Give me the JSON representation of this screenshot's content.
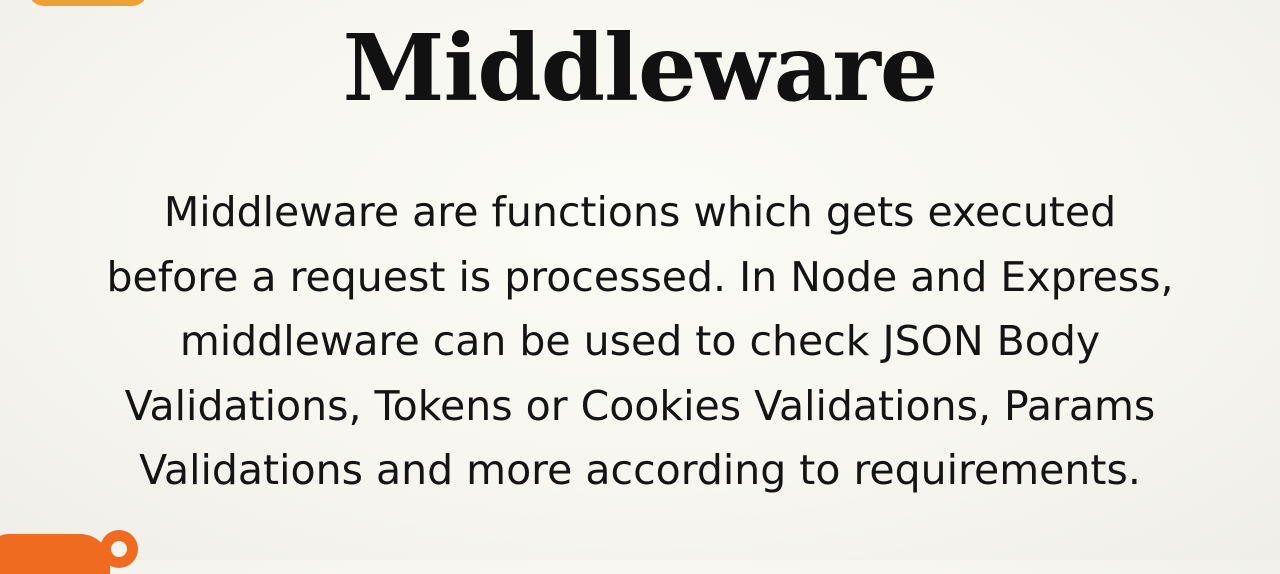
{
  "slide": {
    "title": "Middleware",
    "body_lines": [
      "Middleware are functions which gets executed",
      "before a request is processed. In Node and Express,",
      "middleware can be used to check JSON Body",
      "Validations, Tokens or Cookies Validations, Params",
      "Validations and more according to requirements."
    ]
  },
  "colors": {
    "background": "#f7f6f0",
    "text": "#111111",
    "accent_orange": "#ef6b1f",
    "accent_yellow": "#f0a033"
  }
}
